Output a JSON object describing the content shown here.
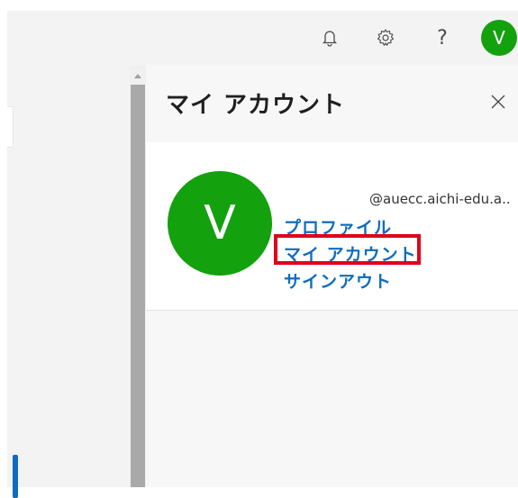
{
  "topbar": {
    "icons": [
      "bell-icon",
      "gear-icon",
      "help-icon"
    ],
    "help_glyph": "?",
    "avatar_initial": "V"
  },
  "panel": {
    "title": "マイ アカウント",
    "close_glyph": "×",
    "account": {
      "avatar_initial": "V",
      "email": "@auecc.aichi-edu.a..",
      "links": {
        "profile": "プロファイル",
        "my_account": "マイ アカウント",
        "sign_out": "サインアウト"
      }
    }
  },
  "colors": {
    "avatar": "#13a10e",
    "link": "#0f6cbd",
    "highlight": "#e0001b"
  }
}
